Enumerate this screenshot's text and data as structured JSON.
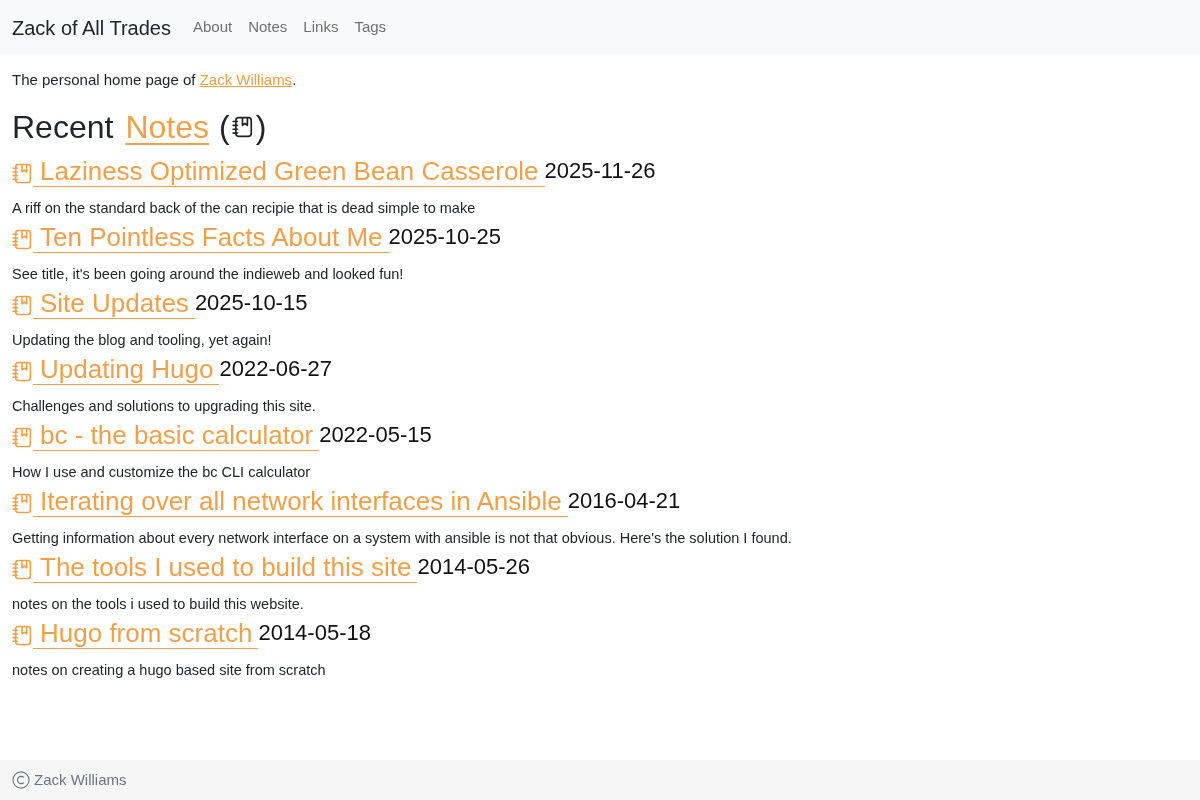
{
  "navbar": {
    "brand": "Zack of All Trades",
    "links": [
      "About",
      "Notes",
      "Links",
      "Tags"
    ]
  },
  "intro": {
    "text": "The personal home page of",
    "link": "Zack Williams",
    "end": "."
  },
  "heading": {
    "text": "Recent",
    "link": "Notes",
    "open": "(",
    "close": ")"
  },
  "notes": [
    {
      "title": "Laziness Optimized Green Bean Casserole",
      "date": "2025-11-26",
      "summary": "A riff on the standard back of the can recipie that is dead simple to make"
    },
    {
      "title": "Ten Pointless Facts About Me",
      "date": "2025-10-25",
      "summary": "See title, it's been going around the indieweb and looked fun!"
    },
    {
      "title": "Site Updates",
      "date": "2025-10-15",
      "summary": "Updating the blog and tooling, yet again!"
    },
    {
      "title": "Updating Hugo",
      "date": "2022-06-27",
      "summary": "Challenges and solutions to upgrading this site."
    },
    {
      "title": "bc - the basic calculator",
      "date": "2022-05-15",
      "summary": "How I use and customize the bc CLI calculator"
    },
    {
      "title": "Iterating over all network interfaces in Ansible",
      "date": "2016-04-21",
      "summary": "Getting information about every network interface on a system with ansible is not that obvious. Here's the solution I found."
    },
    {
      "title": "The tools I used to build this site",
      "date": "2014-05-26",
      "summary": "notes on the tools i used to build this website."
    },
    {
      "title": "Hugo from scratch",
      "date": "2014-05-18",
      "summary": "notes on creating a hugo based site from scratch"
    }
  ],
  "footer": {
    "text": "Zack Williams"
  }
}
